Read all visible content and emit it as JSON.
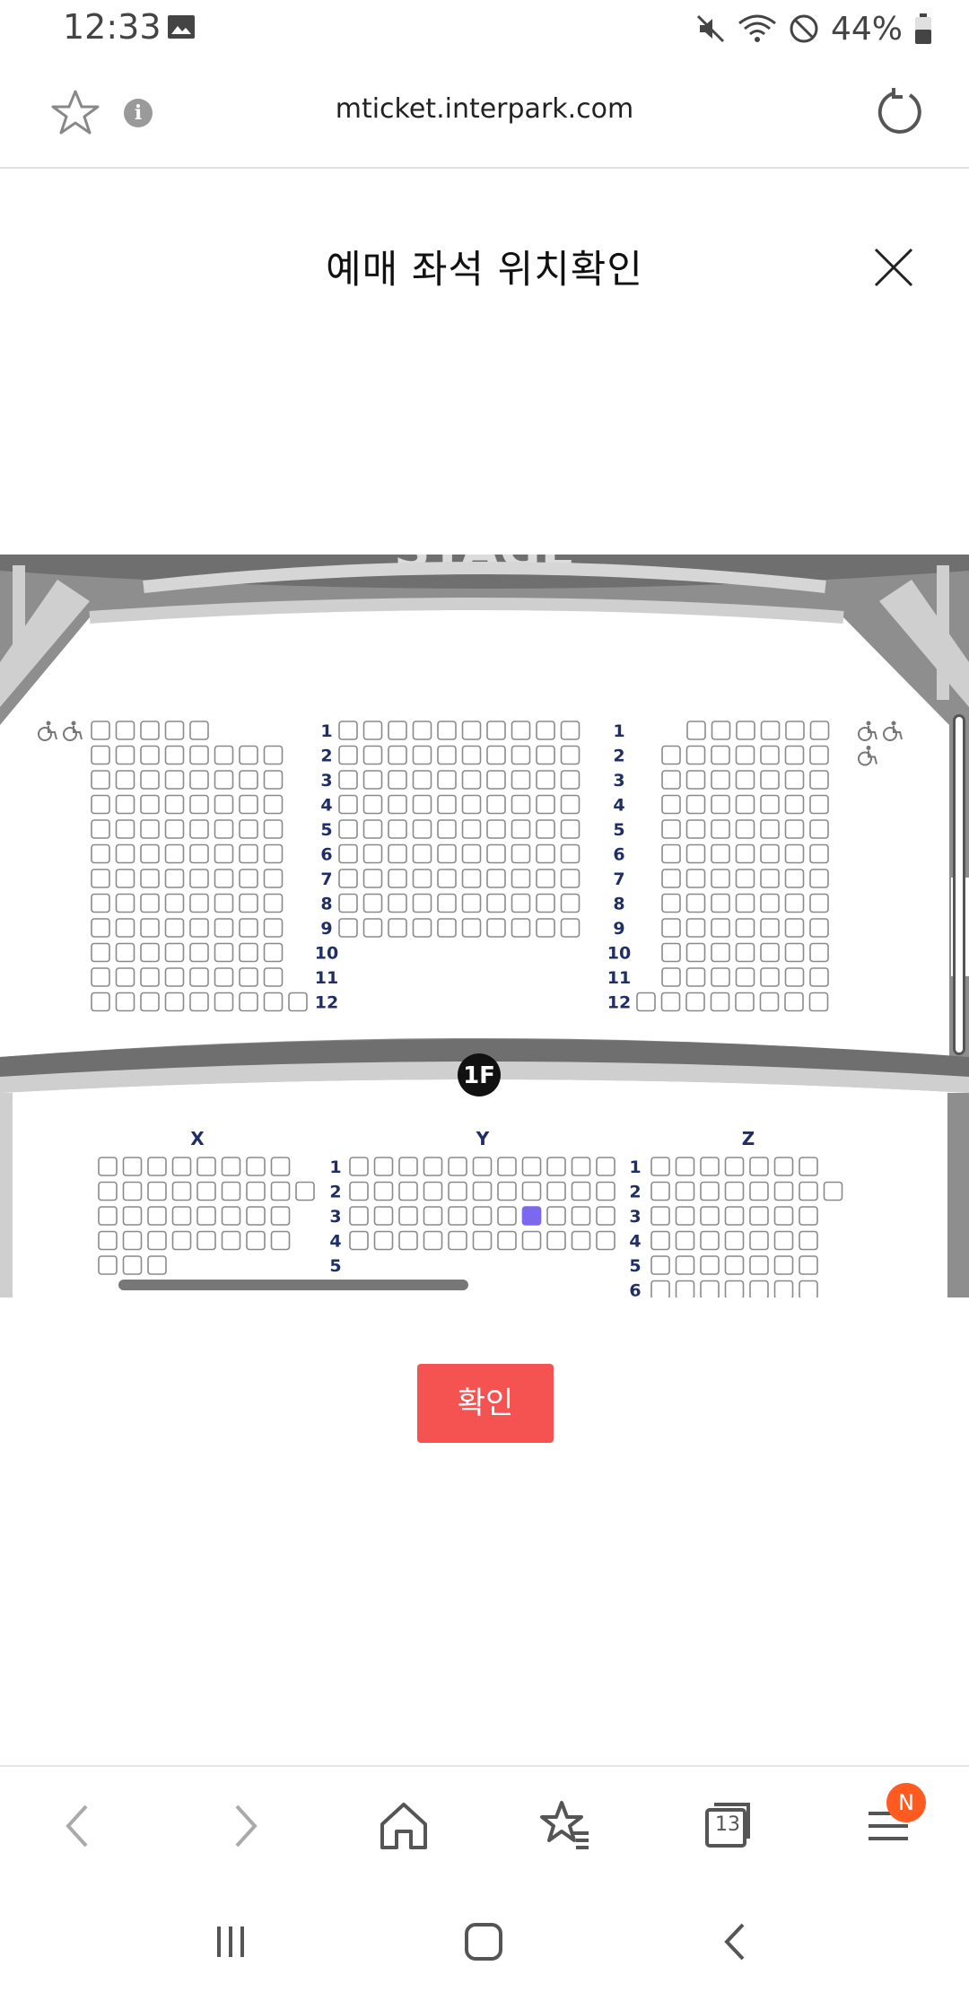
{
  "status": {
    "time": "12:33",
    "battery": "44%"
  },
  "browser": {
    "url": "mticket.interpark.com",
    "tab_count": "13",
    "menu_badge": "N"
  },
  "modal": {
    "title": "예매 좌석 위치확인",
    "confirm_label": "확인"
  },
  "seatmap": {
    "stage_label": "STAGE",
    "floor_label": "1F",
    "upper_rows": [
      "1",
      "2",
      "3",
      "4",
      "5",
      "6",
      "7",
      "8",
      "9",
      "10",
      "11",
      "12"
    ],
    "lower_sections": [
      "X",
      "Y",
      "Z"
    ],
    "lower_rows_left": [
      "1",
      "2",
      "3",
      "4",
      "5"
    ],
    "lower_rows_right": [
      "1",
      "2",
      "3",
      "4",
      "5",
      "6"
    ],
    "selected_seat": {
      "section": "Y",
      "row": "3",
      "seat_index": 7
    }
  },
  "colors": {
    "accent": "#f45352",
    "selected_seat": "#7b68ee",
    "badge": "#ff5a1f"
  }
}
